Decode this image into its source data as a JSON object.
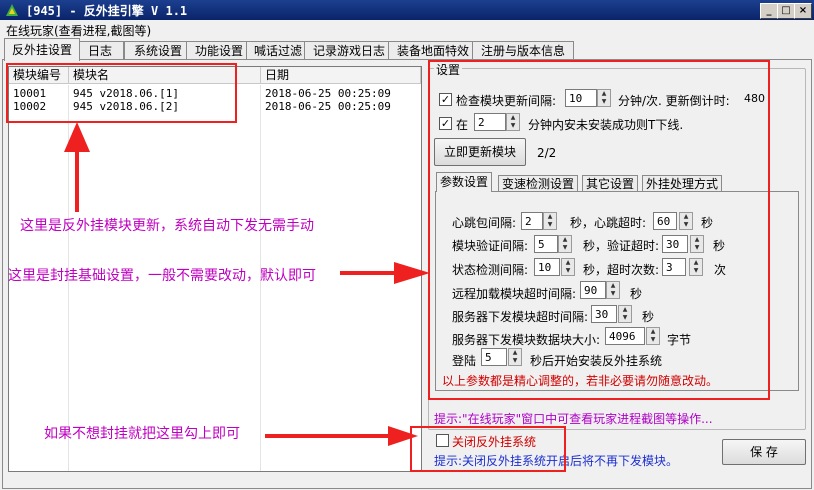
{
  "window": {
    "title": "[945] - 反外挂引擎 V 1.1",
    "min_symbol": "_",
    "max_symbol": "□",
    "close_symbol": "×"
  },
  "menu_label": "在线玩家(查看进程,截图等)",
  "tabs": [
    "反外挂设置",
    "日志",
    "系统设置",
    "功能设置",
    "喊话过滤",
    "记录游戏日志",
    "装备地面特效",
    "注册与版本信息"
  ],
  "module_list": {
    "columns": [
      "模块编号",
      "模块名",
      "日期"
    ],
    "rows": [
      {
        "id": "10001",
        "name": "945 v2018.06.[1]",
        "date": "2018-06-25 00:25:09"
      },
      {
        "id": "10002",
        "name": "945 v2018.06.[2]",
        "date": "2018-06-25 00:25:09"
      }
    ]
  },
  "settings": {
    "group_title": "设置",
    "check_update": {
      "checked": true,
      "label": "检查模块更新间隔:",
      "value": "10",
      "unit": "分钟/次. 更新倒计时:",
      "countdown": "480"
    },
    "kick": {
      "checked": true,
      "label": "在",
      "value": "2",
      "suffix": "分钟内安未安装成功则T下线."
    },
    "update_now_button": "立即更新模块",
    "progress_text": "2/2",
    "inner_tabs": [
      "参数设置",
      "变速检测设置",
      "其它设置",
      "外挂处理方式"
    ],
    "params": {
      "heartbeat_label": "心跳包间隔:",
      "heartbeat_value": "2",
      "sec1": "秒，心跳超时:",
      "heartbeat_timeout": "60",
      "sec2": "秒",
      "verify_label": "模块验证间隔:",
      "verify_value": "5",
      "sec3": "秒，验证超时:",
      "verify_timeout": "30",
      "sec4": "秒",
      "state_label": "状态检测间隔:",
      "state_value": "10",
      "sec5": "秒，超时次数:",
      "state_timeout_count": "3",
      "times": "次",
      "remote_label": "远程加载模块超时间隔:",
      "remote_value": "90",
      "sec6": "秒",
      "server_label": "服务器下发模块超时间隔:",
      "server_value": "30",
      "sec7": "秒",
      "block_label": "服务器下发模块数据块大小:",
      "block_value": "4096",
      "bytes": "字节",
      "login_label": "登陆",
      "login_value": "5",
      "login_suffix": "秒后开始安装反外挂系统",
      "warning": "以上参数都是精心调整的，若非必要请勿随意改动。"
    }
  },
  "hint_online": "提示:\"在线玩家\"窗口中可查看玩家进程截图等操作...",
  "disable_checkbox": {
    "checked": false,
    "label": "关闭反外挂系统"
  },
  "hint_disable": "提示:关闭反外挂系统开启后将不再下发模块。",
  "save_button": "保 存",
  "annotations": {
    "module_note": "这里是反外挂模块更新，系统自动下发无需手动",
    "base_note": "这里是封挂基础设置，一般不需要改动，默认即可",
    "disable_note": "如果不想封挂就把这里勾上即可"
  }
}
